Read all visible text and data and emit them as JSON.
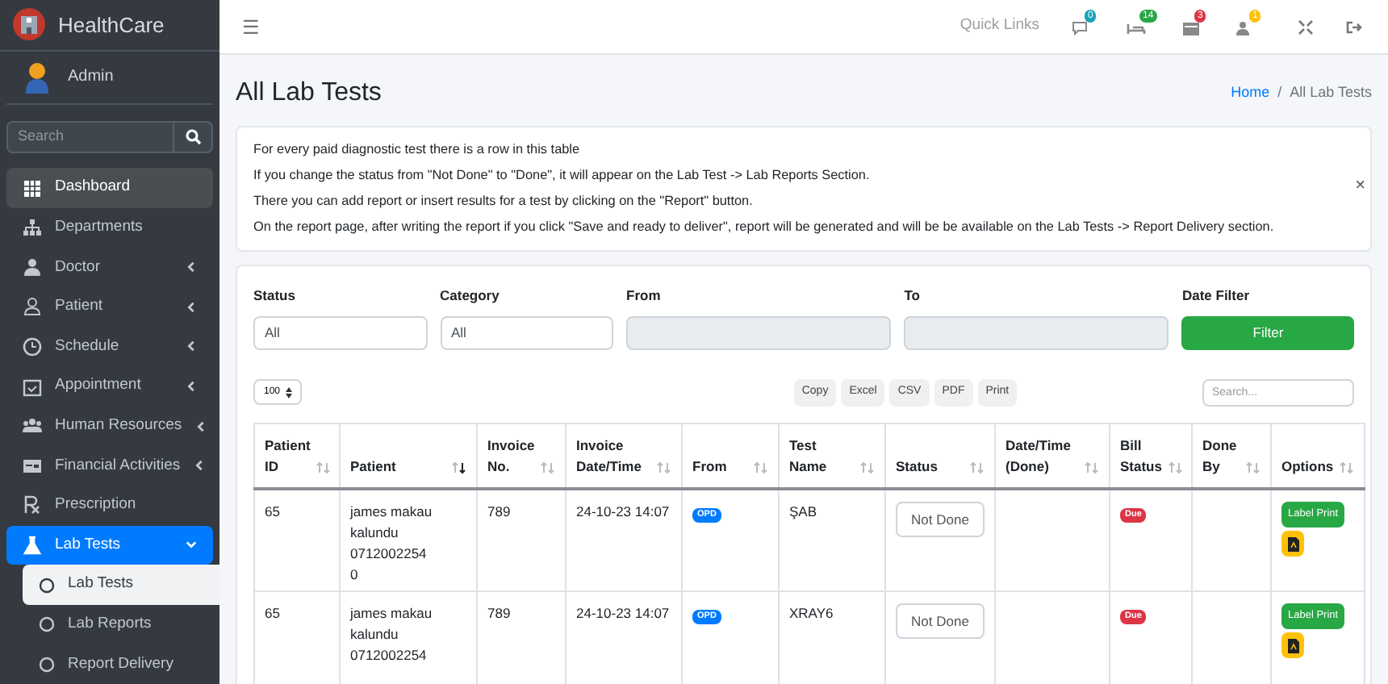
{
  "brand": "HealthCare",
  "user": "Admin",
  "sidebar": {
    "search_placeholder": "Search",
    "items": [
      {
        "label": "Dashboard",
        "selected": false,
        "hovered": true
      },
      {
        "label": "Departments",
        "selected": false,
        "hovered": false
      },
      {
        "label": "Doctor",
        "selected": false,
        "hovered": false,
        "expanded": false
      },
      {
        "label": "Patient",
        "selected": false,
        "hovered": false,
        "expanded": false
      },
      {
        "label": "Schedule",
        "selected": false,
        "hovered": false,
        "expanded": false
      },
      {
        "label": "Appointment",
        "selected": false,
        "hovered": false,
        "expanded": false
      },
      {
        "label": "Human Resources",
        "selected": false,
        "hovered": false,
        "expanded": false
      },
      {
        "label": "Financial Activities",
        "selected": false,
        "hovered": false,
        "expanded": false
      },
      {
        "label": "Prescription",
        "selected": false,
        "hovered": false
      },
      {
        "label": "Lab Tests",
        "selected": true,
        "hovered": false,
        "expanded": true,
        "children": [
          {
            "label": "Lab Tests",
            "selected": true
          },
          {
            "label": "Lab Reports",
            "selected": false
          },
          {
            "label": "Report Delivery",
            "selected": false
          }
        ]
      }
    ]
  },
  "topbar": {
    "menu_glyph": "☰",
    "quick_links": "Quick Links",
    "notifications": [
      {
        "count": "0",
        "color": "#17a2b8"
      },
      {
        "count": "14",
        "color": "#28a745"
      },
      {
        "count": "3",
        "color": "#dc3545"
      },
      {
        "count": "1",
        "color": "#ffc107"
      }
    ]
  },
  "page": {
    "title": "All Lab Tests",
    "breadcrumb": [
      {
        "label": "Home",
        "link": true
      },
      {
        "label": "All Lab Tests",
        "link": false
      }
    ],
    "breadcrumb_separator": "/"
  },
  "info": {
    "lines": [
      "For every paid diagnostic test there is a row in this table",
      "If you change the status from \"Not Done\" to \"Done\", it will appear on the Lab Test -> Lab Reports Section.",
      "There you can add report or insert results for a test by clicking on the \"Report\" button.",
      "On the report page, after writing the report if you click \"Save and ready to deliver\", report will be generated and will be be available on the Lab Tests -> Report Delivery section."
    ],
    "close": "×"
  },
  "filters": {
    "status": {
      "label": "Status",
      "value": "All"
    },
    "category": {
      "label": "Category",
      "value": "All"
    },
    "from": {
      "label": "From"
    },
    "to": {
      "label": "To"
    },
    "date_filter": {
      "label": "Date Filter",
      "button": "Filter"
    }
  },
  "table_tools": {
    "page_size": "100",
    "buttons": [
      "Copy",
      "Excel",
      "CSV",
      "PDF",
      "Print"
    ],
    "search_placeholder": "Search..."
  },
  "table": {
    "columns": [
      {
        "label": "Patient ID",
        "sorted": false
      },
      {
        "label": "Patient",
        "sorted": true
      },
      {
        "label": "Invoice No.",
        "sorted": false
      },
      {
        "label": "Invoice Date/Time",
        "sorted": false
      },
      {
        "label": "From",
        "sorted": false
      },
      {
        "label": "Test Name",
        "sorted": false
      },
      {
        "label": "Status",
        "sorted": false
      },
      {
        "label": "Date/Time (Done)",
        "sorted": false
      },
      {
        "label": "Bill Status",
        "sorted": false
      },
      {
        "label": "Done By",
        "sorted": false
      },
      {
        "label": "Options",
        "sorted": false
      }
    ],
    "rows": [
      {
        "patient_id": "65",
        "patient": [
          "james makau",
          "kalundu",
          "0712002254",
          "0"
        ],
        "invoice_no": "789",
        "invoice_datetime": "24-10-23 14:07",
        "from": "OPD",
        "test_name": "ŞAB",
        "status": "Not Done",
        "bill_status": "Due",
        "label_print": "Label Print"
      },
      {
        "patient_id": "65",
        "patient": [
          "james makau",
          "kalundu",
          "0712002254"
        ],
        "invoice_no": "789",
        "invoice_datetime": "24-10-23 14:07",
        "from": "OPD",
        "test_name": "XRAY6",
        "status": "Not Done",
        "bill_status": "Due",
        "label_print": "Label Print"
      }
    ]
  }
}
